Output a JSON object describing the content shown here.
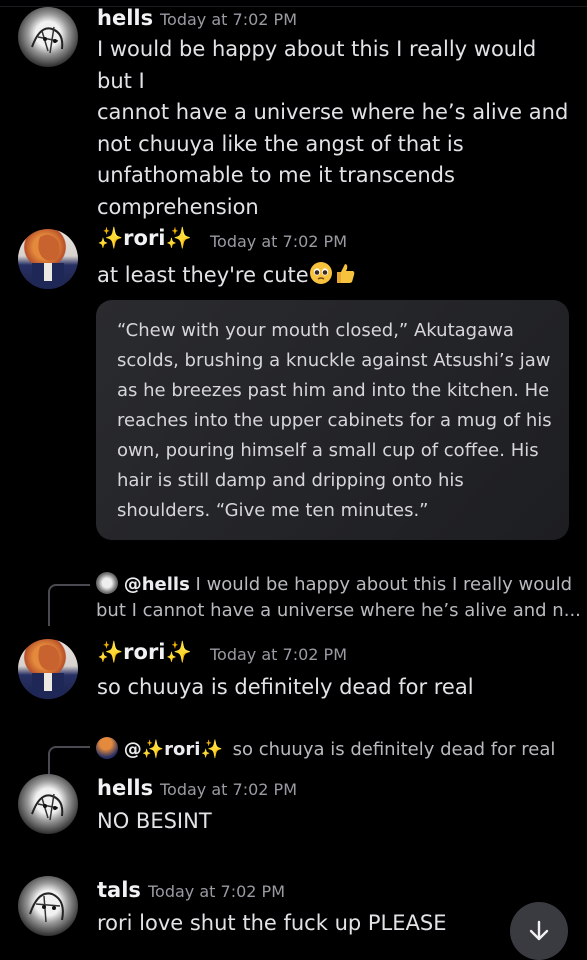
{
  "messages": [
    {
      "author": "hells",
      "time": "Today at 7:02 PM",
      "lines": [
        "I would be happy about this I really would but I",
        "cannot have a universe where he’s alive and",
        "not chuuya like the angst of that is",
        "unfathomable to me it transcends",
        "comprehension"
      ]
    },
    {
      "author": "rori",
      "author_sparkle": "✨",
      "time": "Today at 7:02 PM",
      "text": "at least they're cute",
      "emojis": [
        "pleading-face",
        "thumbs-up"
      ],
      "quote_lines": [
        "“Chew with your mouth closed,” Akutagawa",
        "scolds, brushing a knuckle against Atsushi’s jaw",
        "as he breezes past him and into the kitchen. He",
        "reaches into the upper cabinets for a mug of his",
        "own, pouring himself a small cup of coffee. His",
        "hair is still damp and dripping onto his",
        "shoulders. “Give me ten minutes.”"
      ]
    },
    {
      "reply_to": "@hells",
      "reply_snippet_1": "I would be happy about this I really would",
      "reply_snippet_2": "but I cannot have a universe where he’s alive and n...",
      "author": "rori",
      "time": "Today at 7:02 PM",
      "text": "so chuuya is definitely dead for real"
    },
    {
      "reply_to": "@",
      "reply_to_name": "rori",
      "reply_snippet": "so chuuya is definitely dead for real",
      "author": "hells",
      "time": "Today at 7:02 PM",
      "text": "NO BESINT"
    },
    {
      "author": "tals",
      "time": "Today at 7:02 PM",
      "text": "rori love shut the fuck up PLEASE"
    }
  ],
  "scroll_button_icon": "arrow-down-icon",
  "colors": {
    "background": "#000000",
    "quote_bg": "#232428",
    "sparkle": "#f5c84b",
    "scroll_button": "#3a3b40"
  }
}
